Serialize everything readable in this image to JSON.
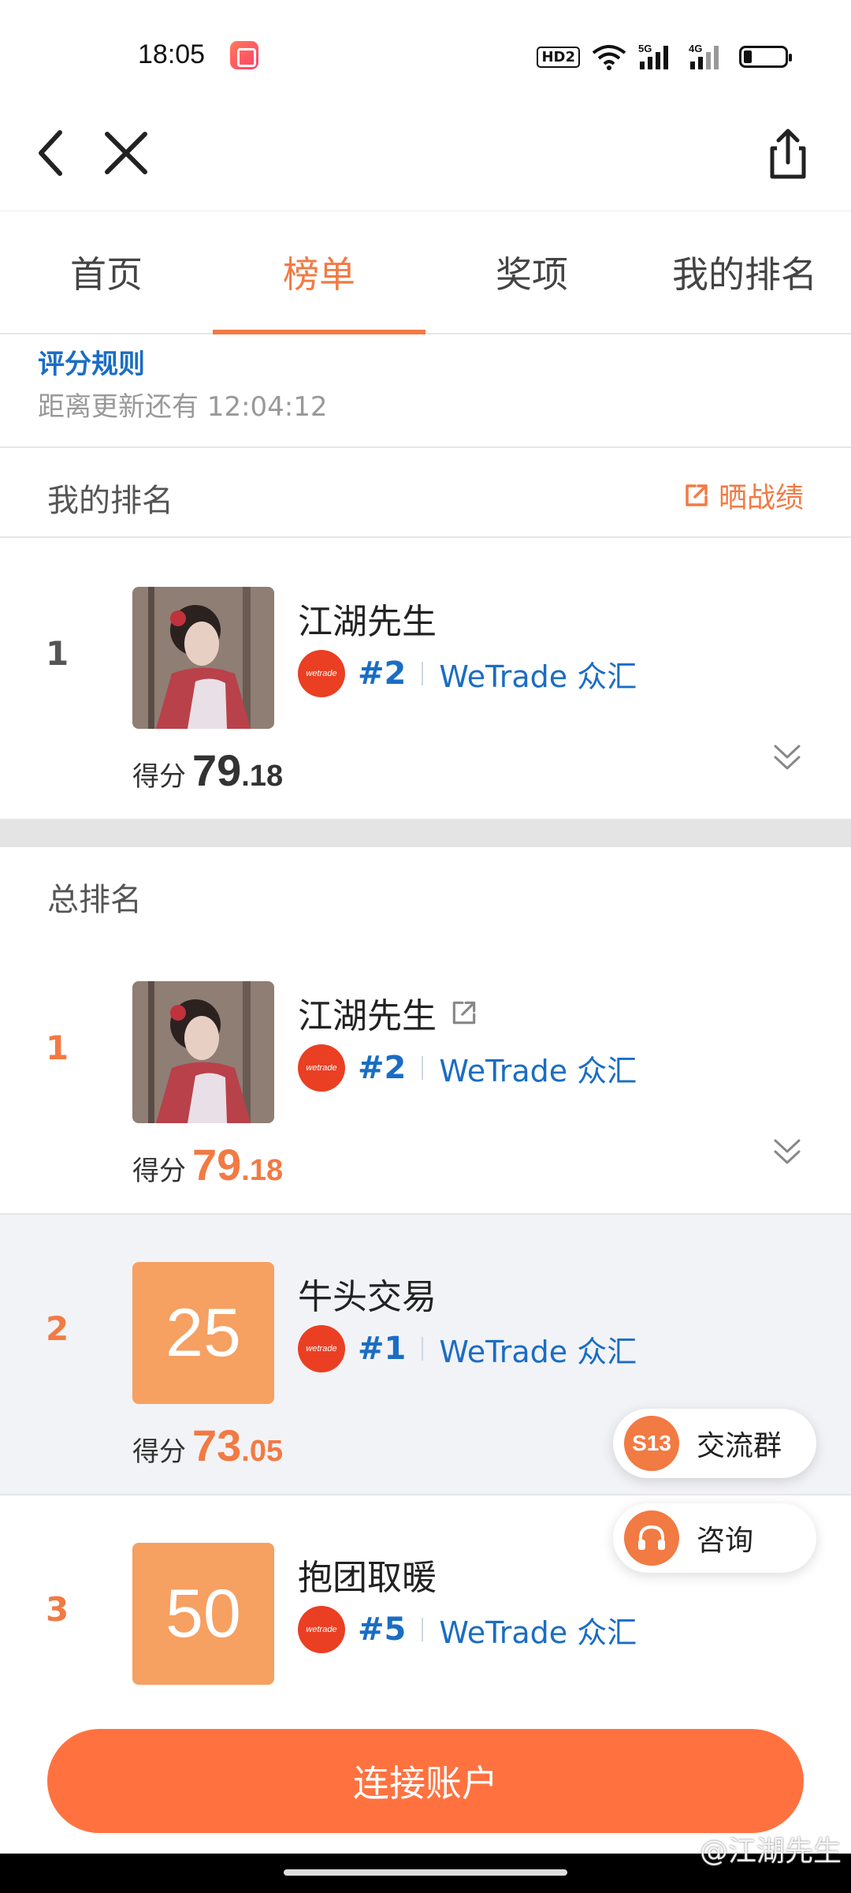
{
  "status_bar": {
    "time": "18:05",
    "hd_label": "HD2",
    "sig1": "5G",
    "sig2": "4G"
  },
  "tabs": [
    {
      "label": "首页"
    },
    {
      "label": "榜单"
    },
    {
      "label": "奖项"
    },
    {
      "label": "我的排名"
    }
  ],
  "rules": {
    "link": "评分规则",
    "countdown": "距离更新还有 12:04:12"
  },
  "my_rank": {
    "header": "我的排名",
    "share_label": "晒战绩",
    "entry": {
      "rank": "1",
      "name": "江湖先生",
      "broker_logo_text": "wetrade",
      "broker_rank": "#2",
      "broker_name": "WeTrade 众汇",
      "score_label": "得分",
      "score_int": "79",
      "score_dec": ".18"
    }
  },
  "overall": {
    "header": "总排名",
    "entries": [
      {
        "rank": "1",
        "name": "江湖先生",
        "broker_logo_text": "wetrade",
        "broker_rank": "#2",
        "broker_name": "WeTrade 众汇",
        "score_label": "得分",
        "score_int": "79",
        "score_dec": ".18"
      },
      {
        "rank": "2",
        "avatar_text": "25",
        "name": "牛头交易",
        "broker_logo_text": "wetrade",
        "broker_rank": "#1",
        "broker_name": "WeTrade 众汇",
        "score_label": "得分",
        "score_int": "73",
        "score_dec": ".05"
      },
      {
        "rank": "3",
        "avatar_text": "50",
        "name": "抱团取暖",
        "broker_logo_text": "wetrade",
        "broker_rank": "#5",
        "broker_name": "WeTrade 众汇"
      }
    ]
  },
  "floating": {
    "group": {
      "icon_text": "S13",
      "label": "交流群"
    },
    "consult": {
      "label": "咨询"
    }
  },
  "connect_button": "连接账户",
  "watermark": "@江湖先生",
  "colors": {
    "accent": "#f27a43",
    "link_blue": "#1a6dc4",
    "button_orange": "#ff7240",
    "avatar_orange": "#f6a062"
  }
}
